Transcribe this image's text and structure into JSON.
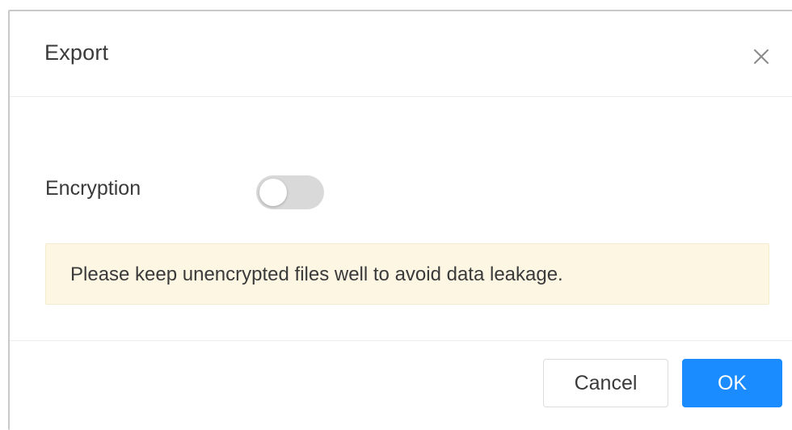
{
  "dialog": {
    "title": "Export",
    "close_icon": "close-icon"
  },
  "encryption": {
    "label": "Encryption",
    "enabled": false
  },
  "notice": {
    "text": "Please keep unencrypted files well to avoid data leakage."
  },
  "footer": {
    "cancel_label": "Cancel",
    "ok_label": "OK"
  },
  "colors": {
    "primary": "#1a8cff",
    "notice_bg": "#fdf6e3",
    "toggle_off": "#d9d9d9"
  }
}
